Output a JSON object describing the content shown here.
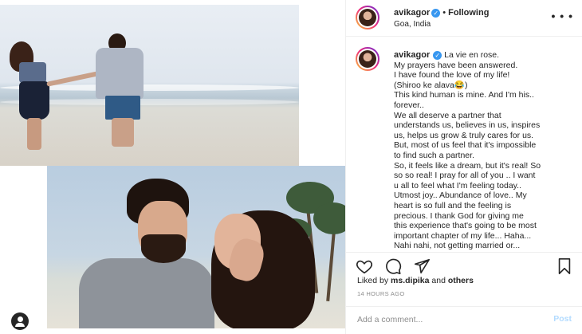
{
  "post": {
    "username": "avikagor",
    "follow_status": "Following",
    "location": "Goa, India",
    "more_symbol": "• • •"
  },
  "caption": {
    "username": "avikagor",
    "lines": [
      "La vie en rose.",
      "My prayers have been answered.",
      "I have found the love of my life!",
      "(Shiroo ke alava😂)",
      "This kind human is mine. And I'm his..",
      "forever..",
      "We all deserve a partner that",
      "understands us, believes in us, inspires",
      "us, helps us grow & truly cares for us.",
      "But, most of us feel that it's impossible",
      "to find such a partner.",
      "So, it feels like a dream, but it's real! So",
      "so so real! I pray for all of you .. I want",
      "u all to feel what I'm feeling today..",
      "Utmost joy.. Abundance of love.. My",
      "heart is so full and the feeling is",
      "precious. I thank God for giving me",
      "this experience that's going to be most",
      "important chapter of my life... Haha...",
      "Nahi nahi, not getting married or..."
    ]
  },
  "likes": {
    "prefix": "Liked by",
    "user": "ms.dipika",
    "connector": "and",
    "others": "others"
  },
  "timestamp": "14 HOURS AGO",
  "comment": {
    "placeholder": "Add a comment...",
    "post_label": "Post"
  },
  "icons": {
    "verified": "verified-badge-icon",
    "like": "heart-icon",
    "comment": "comment-bubble-icon",
    "share": "paper-plane-icon",
    "save": "bookmark-icon",
    "profile": "user-icon"
  },
  "colors": {
    "verified_blue": "#3897f0",
    "post_button": "#b3dbff",
    "text": "#262626",
    "muted": "#8e8e8e"
  }
}
